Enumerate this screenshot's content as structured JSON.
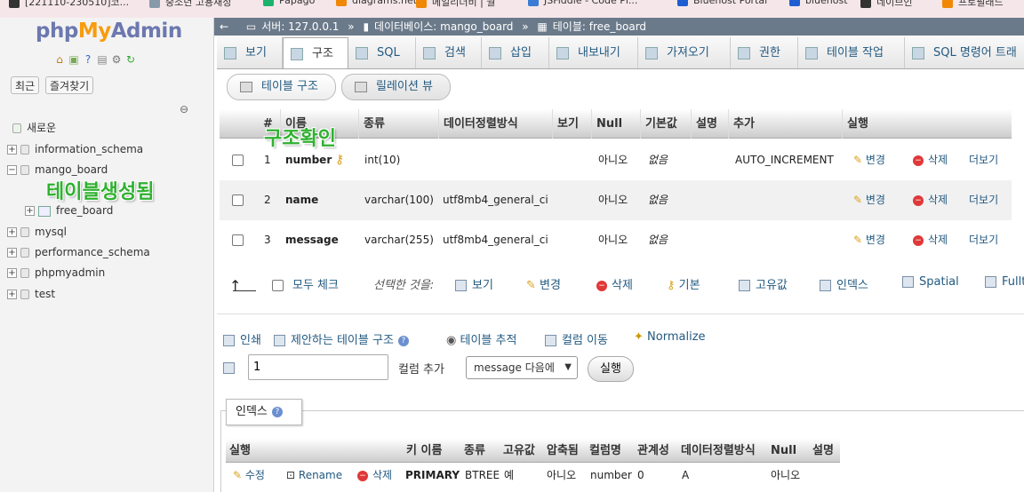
{
  "bookmarks": [
    {
      "label": "[221110-230510]코...",
      "icon": "n-icon",
      "color": "#333333"
    },
    {
      "label": "중소년 고용재정",
      "icon": "folder-icon",
      "color": "#8899aa"
    },
    {
      "label": "Papago",
      "icon": "papago-icon",
      "color": "#1bb36b"
    },
    {
      "label": "diagrams.net",
      "icon": "diagrams-icon",
      "color": "#f08705"
    },
    {
      "label": "메일리더비 | 월",
      "icon": "mail-icon",
      "color": "#f08705"
    },
    {
      "label": "JSFiddle - Code Pl...",
      "icon": "jsfiddle-icon",
      "color": "#3a7bd5"
    },
    {
      "label": "Bluehost Portal",
      "icon": "bluehost-icon",
      "color": "#1d5cd3"
    },
    {
      "label": "bluehost",
      "icon": "bluehost-icon",
      "color": "#1d5cd3"
    },
    {
      "label": "네이브인",
      "icon": "diamond-icon",
      "color": "#333333"
    },
    {
      "label": "프로필래드",
      "icon": "profile-icon",
      "color": "#f08705"
    }
  ],
  "sidebar": {
    "logo": {
      "php": "php",
      "my": "My",
      "admin": "Admin"
    },
    "recent_label": "최근",
    "favorites_label": "즐겨찾기",
    "tree": [
      {
        "label": "새로운",
        "type": "new"
      },
      {
        "label": "information_schema",
        "type": "db"
      },
      {
        "label": "mango_board",
        "type": "db-open"
      },
      {
        "label": "free_board",
        "type": "table"
      },
      {
        "label": "mysql",
        "type": "db"
      },
      {
        "label": "performance_schema",
        "type": "db"
      },
      {
        "label": "phpmyadmin",
        "type": "db"
      },
      {
        "label": "test",
        "type": "db"
      }
    ],
    "annotation_table_created": "테이블생성됨"
  },
  "annotation_structure_check": "구조확인",
  "breadcrumb": {
    "server": "서버: 127.0.0.1",
    "database": "데이터베이스: mango_board",
    "table": "테이블: free_board"
  },
  "tabs": [
    "보기",
    "구조",
    "SQL",
    "검색",
    "삽입",
    "내보내기",
    "가져오기",
    "권한",
    "테이블 작업",
    "SQL 명령어 트래"
  ],
  "active_tab": "구조",
  "subtabs": [
    "테이블 구조",
    "릴레이션 뷰"
  ],
  "structure": {
    "headers": [
      "#",
      "이름",
      "종류",
      "데이터정렬방식",
      "보기",
      "Null",
      "기본값",
      "설명",
      "추가",
      "실행"
    ],
    "rows": [
      {
        "num": "1",
        "name": "number",
        "type": "int(10)",
        "collation": "",
        "null": "아니오",
        "default": "없음",
        "extra": "AUTO_INCREMENT",
        "primary_key": true
      },
      {
        "num": "2",
        "name": "name",
        "type": "varchar(100)",
        "collation": "utf8mb4_general_ci",
        "null": "아니오",
        "default": "없음",
        "extra": "",
        "primary_key": false
      },
      {
        "num": "3",
        "name": "message",
        "type": "varchar(255)",
        "collation": "utf8mb4_general_ci",
        "null": "아니오",
        "default": "없음",
        "extra": "",
        "primary_key": false
      }
    ],
    "row_actions": {
      "change": "변경",
      "delete": "삭제",
      "more": "더보기"
    }
  },
  "bulk": {
    "check_all": "모두 체크",
    "with_selected": "선택한 것을:",
    "actions": [
      "보기",
      "변경",
      "삭제",
      "기본",
      "고유값",
      "인덱스",
      "Spatial",
      "Fullt"
    ]
  },
  "links": {
    "print": "인쇄",
    "propose": "제안하는 테이블 구조",
    "track": "테이블 추적",
    "move_columns": "컬럼 이동",
    "normalize": "Normalize"
  },
  "add_columns": {
    "count": "1",
    "label": "컬럼 추가",
    "position": "message 다음에",
    "go": "실행"
  },
  "indexes": {
    "legend": "인덱스",
    "headers": [
      "실행",
      "키 이름",
      "종류",
      "고유값",
      "압축됨",
      "컬럼명",
      "관계성",
      "데이터정렬방식",
      "Null",
      "설명"
    ],
    "row": {
      "edit": "수정",
      "rename": "Rename",
      "delete": "삭제",
      "key_name": "PRIMARY",
      "type": "BTREE",
      "unique": "예",
      "packed": "아니오",
      "column": "number",
      "cardinality": "0",
      "collation": "A",
      "null": "아니오",
      "comment": ""
    }
  }
}
